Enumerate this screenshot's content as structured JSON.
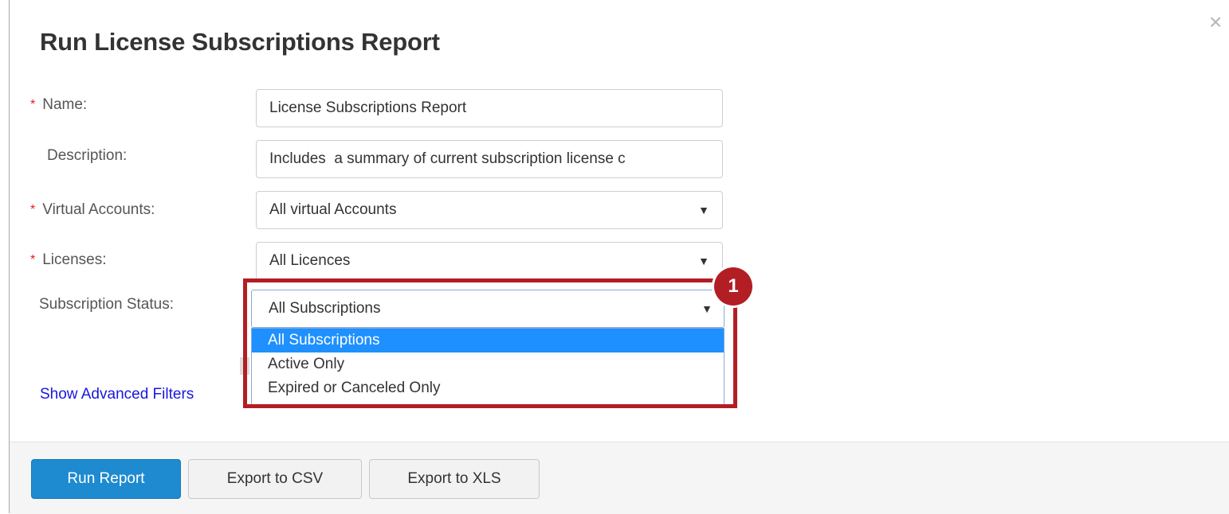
{
  "dialog": {
    "title": "Run License Subscriptions Report",
    "close_glyph": "×"
  },
  "form": {
    "required_mark": "*",
    "name": {
      "label": "Name:",
      "value": "License Subscriptions Report",
      "required": true
    },
    "description": {
      "label": "Description:",
      "value": "Includes  a summary of current subscription license c",
      "required": false
    },
    "virtual_accounts": {
      "label": "Virtual Accounts:",
      "value": "All virtual Accounts",
      "required": true
    },
    "licenses": {
      "label": "Licenses:",
      "value": "All Licences",
      "required": true
    },
    "subscription_status": {
      "label": "Subscription Status:",
      "value": "All Subscriptions",
      "options": [
        "All Subscriptions",
        "Active Only",
        "Expired or Canceled Only"
      ],
      "selected_index": 0
    },
    "caret_glyph": "▼"
  },
  "advanced_link": "Show Advanced Filters",
  "callout": {
    "number": "1"
  },
  "footer": {
    "run_report": "Run Report",
    "export_csv": "Export to CSV",
    "export_xls": "Export to XLS"
  },
  "colors": {
    "primary": "#1e8ad0",
    "highlight": "#b21e24",
    "link": "#1717e0",
    "required": "#e31a1a"
  }
}
